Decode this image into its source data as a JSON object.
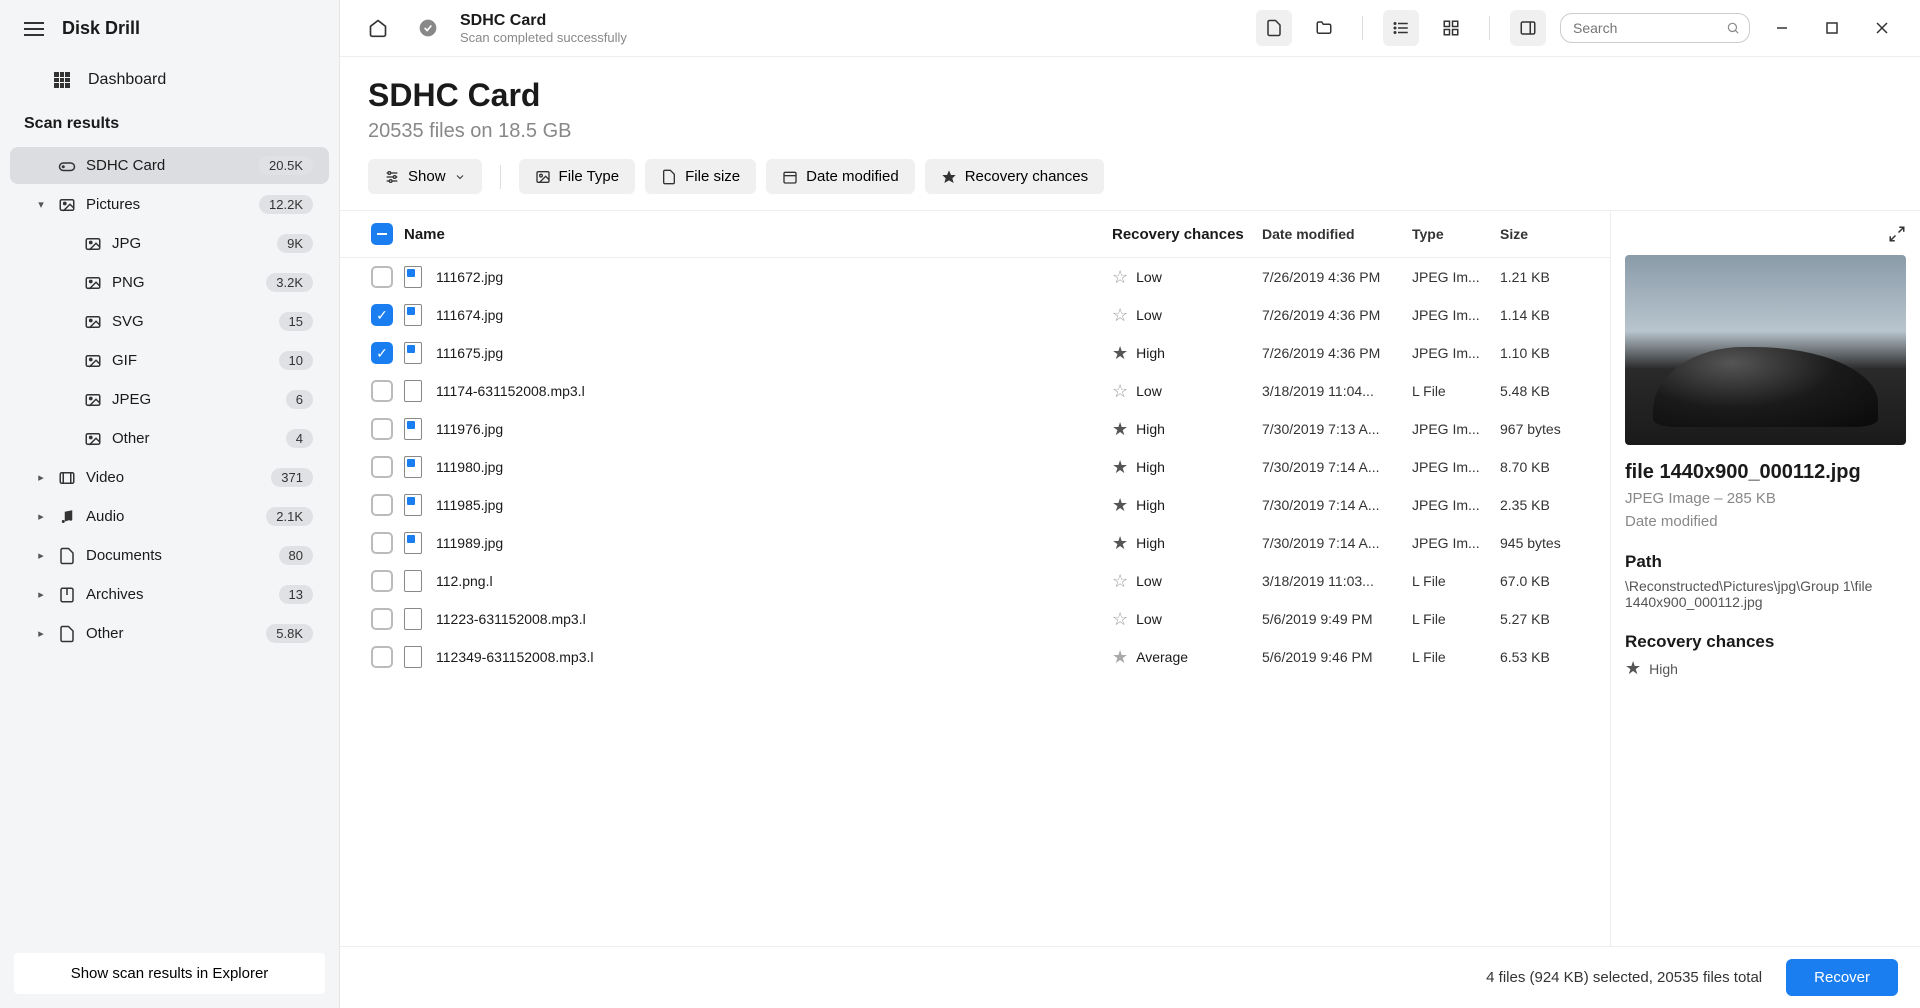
{
  "app_name": "Disk Drill",
  "sidebar": {
    "dashboard": "Dashboard",
    "section_title": "Scan results",
    "footer_button": "Show scan results in Explorer",
    "items": [
      {
        "label": "SDHC Card",
        "count": "20.5K",
        "icon": "drive",
        "active": true,
        "has_chevron": false,
        "expanded": false,
        "child": false
      },
      {
        "label": "Pictures",
        "count": "12.2K",
        "icon": "image",
        "active": false,
        "has_chevron": true,
        "expanded": true,
        "child": false
      },
      {
        "label": "JPG",
        "count": "9K",
        "icon": "image",
        "active": false,
        "has_chevron": false,
        "expanded": false,
        "child": true
      },
      {
        "label": "PNG",
        "count": "3.2K",
        "icon": "image",
        "active": false,
        "has_chevron": false,
        "expanded": false,
        "child": true
      },
      {
        "label": "SVG",
        "count": "15",
        "icon": "image",
        "active": false,
        "has_chevron": false,
        "expanded": false,
        "child": true
      },
      {
        "label": "GIF",
        "count": "10",
        "icon": "image",
        "active": false,
        "has_chevron": false,
        "expanded": false,
        "child": true
      },
      {
        "label": "JPEG",
        "count": "6",
        "icon": "image",
        "active": false,
        "has_chevron": false,
        "expanded": false,
        "child": true
      },
      {
        "label": "Other",
        "count": "4",
        "icon": "image",
        "active": false,
        "has_chevron": false,
        "expanded": false,
        "child": true
      },
      {
        "label": "Video",
        "count": "371",
        "icon": "video",
        "active": false,
        "has_chevron": true,
        "expanded": false,
        "child": false
      },
      {
        "label": "Audio",
        "count": "2.1K",
        "icon": "audio",
        "active": false,
        "has_chevron": true,
        "expanded": false,
        "child": false
      },
      {
        "label": "Documents",
        "count": "80",
        "icon": "doc",
        "active": false,
        "has_chevron": true,
        "expanded": false,
        "child": false
      },
      {
        "label": "Archives",
        "count": "13",
        "icon": "archive",
        "active": false,
        "has_chevron": true,
        "expanded": false,
        "child": false
      },
      {
        "label": "Other",
        "count": "5.8K",
        "icon": "other",
        "active": false,
        "has_chevron": true,
        "expanded": false,
        "child": false
      }
    ]
  },
  "topbar": {
    "title": "SDHC Card",
    "subtitle": "Scan completed successfully",
    "search_placeholder": "Search"
  },
  "header": {
    "title": "SDHC Card",
    "subtitle": "20535 files on 18.5 GB"
  },
  "filters": {
    "show": "Show",
    "file_type": "File Type",
    "file_size": "File size",
    "date_modified": "Date modified",
    "recovery_chances": "Recovery chances"
  },
  "table": {
    "headers": {
      "name": "Name",
      "recovery": "Recovery chances",
      "date": "Date modified",
      "type": "Type",
      "size": "Size"
    },
    "rows": [
      {
        "checked": false,
        "name": "111672.jpg",
        "recovery": "Low",
        "recovery_level": "low",
        "date": "7/26/2019 4:36 PM",
        "type": "JPEG Im...",
        "size": "1.21 KB",
        "ftype": "jpg"
      },
      {
        "checked": true,
        "name": "111674.jpg",
        "recovery": "Low",
        "recovery_level": "low",
        "date": "7/26/2019 4:36 PM",
        "type": "JPEG Im...",
        "size": "1.14 KB",
        "ftype": "jpg"
      },
      {
        "checked": true,
        "name": "111675.jpg",
        "recovery": "High",
        "recovery_level": "high",
        "date": "7/26/2019 4:36 PM",
        "type": "JPEG Im...",
        "size": "1.10 KB",
        "ftype": "jpg"
      },
      {
        "checked": false,
        "name": "11174-631152008.mp3.l",
        "recovery": "Low",
        "recovery_level": "low",
        "date": "3/18/2019 11:04...",
        "type": "L File",
        "size": "5.48 KB",
        "ftype": "l"
      },
      {
        "checked": false,
        "name": "111976.jpg",
        "recovery": "High",
        "recovery_level": "high",
        "date": "7/30/2019 7:13 A...",
        "type": "JPEG Im...",
        "size": "967 bytes",
        "ftype": "jpg"
      },
      {
        "checked": false,
        "name": "111980.jpg",
        "recovery": "High",
        "recovery_level": "high",
        "date": "7/30/2019 7:14 A...",
        "type": "JPEG Im...",
        "size": "8.70 KB",
        "ftype": "jpg"
      },
      {
        "checked": false,
        "name": "111985.jpg",
        "recovery": "High",
        "recovery_level": "high",
        "date": "7/30/2019 7:14 A...",
        "type": "JPEG Im...",
        "size": "2.35 KB",
        "ftype": "jpg"
      },
      {
        "checked": false,
        "name": "111989.jpg",
        "recovery": "High",
        "recovery_level": "high",
        "date": "7/30/2019 7:14 A...",
        "type": "JPEG Im...",
        "size": "945 bytes",
        "ftype": "jpg"
      },
      {
        "checked": false,
        "name": "112.png.l",
        "recovery": "Low",
        "recovery_level": "low",
        "date": "3/18/2019 11:03...",
        "type": "L File",
        "size": "67.0 KB",
        "ftype": "l"
      },
      {
        "checked": false,
        "name": "11223-631152008.mp3.l",
        "recovery": "Low",
        "recovery_level": "low",
        "date": "5/6/2019 9:49 PM",
        "type": "L File",
        "size": "5.27 KB",
        "ftype": "l"
      },
      {
        "checked": false,
        "name": "112349-631152008.mp3.l",
        "recovery": "Average",
        "recovery_level": "avg",
        "date": "5/6/2019 9:46 PM",
        "type": "L File",
        "size": "6.53 KB",
        "ftype": "l"
      }
    ]
  },
  "preview": {
    "title": "file 1440x900_000112.jpg",
    "meta": "JPEG Image – 285 KB",
    "date_label": "Date modified",
    "path_label": "Path",
    "path_value": "\\Reconstructed\\Pictures\\jpg\\Group 1\\file 1440x900_000112.jpg",
    "chances_label": "Recovery chances",
    "chances_value": "High"
  },
  "statusbar": {
    "text": "4 files (924 KB) selected, 20535 files total",
    "recover": "Recover"
  }
}
